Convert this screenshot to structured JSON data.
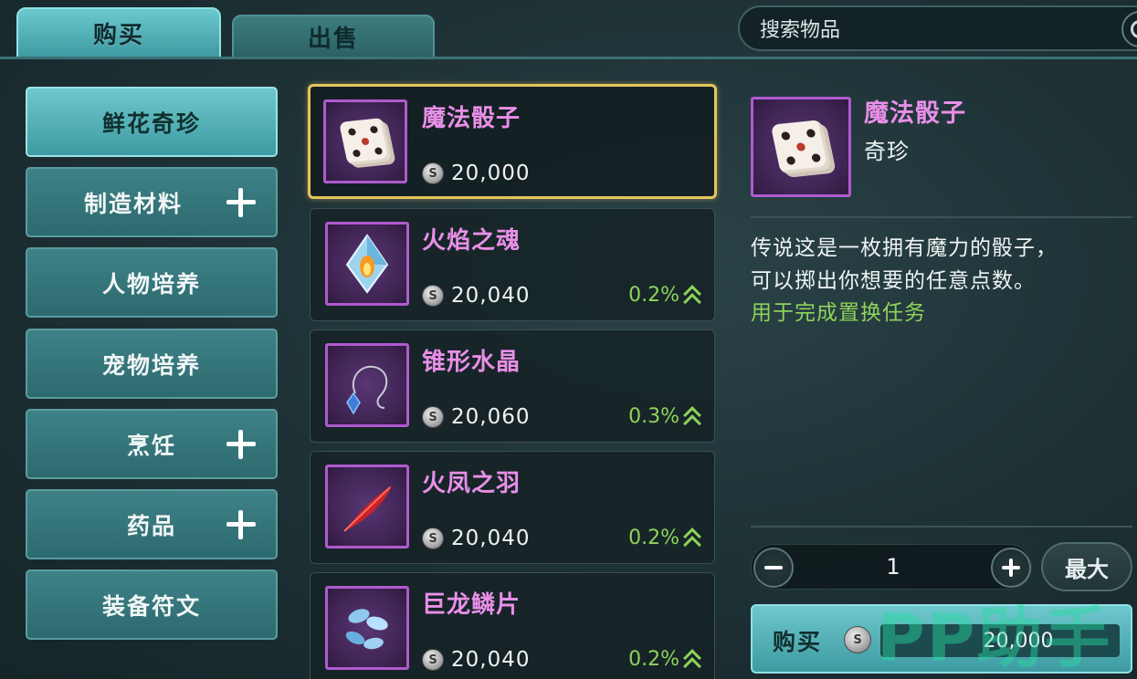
{
  "tabs": {
    "buy": "购买",
    "sell": "出售"
  },
  "search": {
    "placeholder": "搜索物品"
  },
  "categories": [
    {
      "label": "鲜花奇珍",
      "active": true,
      "expandable": false
    },
    {
      "label": "制造材料",
      "active": false,
      "expandable": true
    },
    {
      "label": "人物培养",
      "active": false,
      "expandable": false
    },
    {
      "label": "宠物培养",
      "active": false,
      "expandable": false
    },
    {
      "label": "烹饪",
      "active": false,
      "expandable": true
    },
    {
      "label": "药品",
      "active": false,
      "expandable": true
    },
    {
      "label": "装备符文",
      "active": false,
      "expandable": false
    }
  ],
  "items": [
    {
      "name": "魔法骰子",
      "price": "20,000",
      "change": "",
      "icon": "dice-icon",
      "selected": true
    },
    {
      "name": "火焰之魂",
      "price": "20,040",
      "change": "0.2%",
      "icon": "flame-crystal-icon"
    },
    {
      "name": "锥形水晶",
      "price": "20,060",
      "change": "0.3%",
      "icon": "pendulum-crystal-icon"
    },
    {
      "name": "火凤之羽",
      "price": "20,040",
      "change": "0.2%",
      "icon": "red-feather-icon"
    },
    {
      "name": "巨龙鳞片",
      "price": "20,040",
      "change": "0.2%",
      "icon": "dragon-scale-icon"
    }
  ],
  "detail": {
    "name": "魔法骰子",
    "type": "奇珍",
    "description_line1": "传说这是一枚拥有魔力的骰子，",
    "description_line2": "可以掷出你想要的任意点数。",
    "usage": "用于完成置换任务",
    "quantity": "1",
    "max_label": "最大",
    "buy_label": "购买",
    "total_price": "20,000"
  },
  "watermark": "PP助手",
  "colors": {
    "accent_teal": "#6ec8cd",
    "item_name_pink": "#e98fe8",
    "positive_green": "#8ed35a",
    "selected_gold": "#e6c45a",
    "rarity_purple": "#b05ad0"
  }
}
